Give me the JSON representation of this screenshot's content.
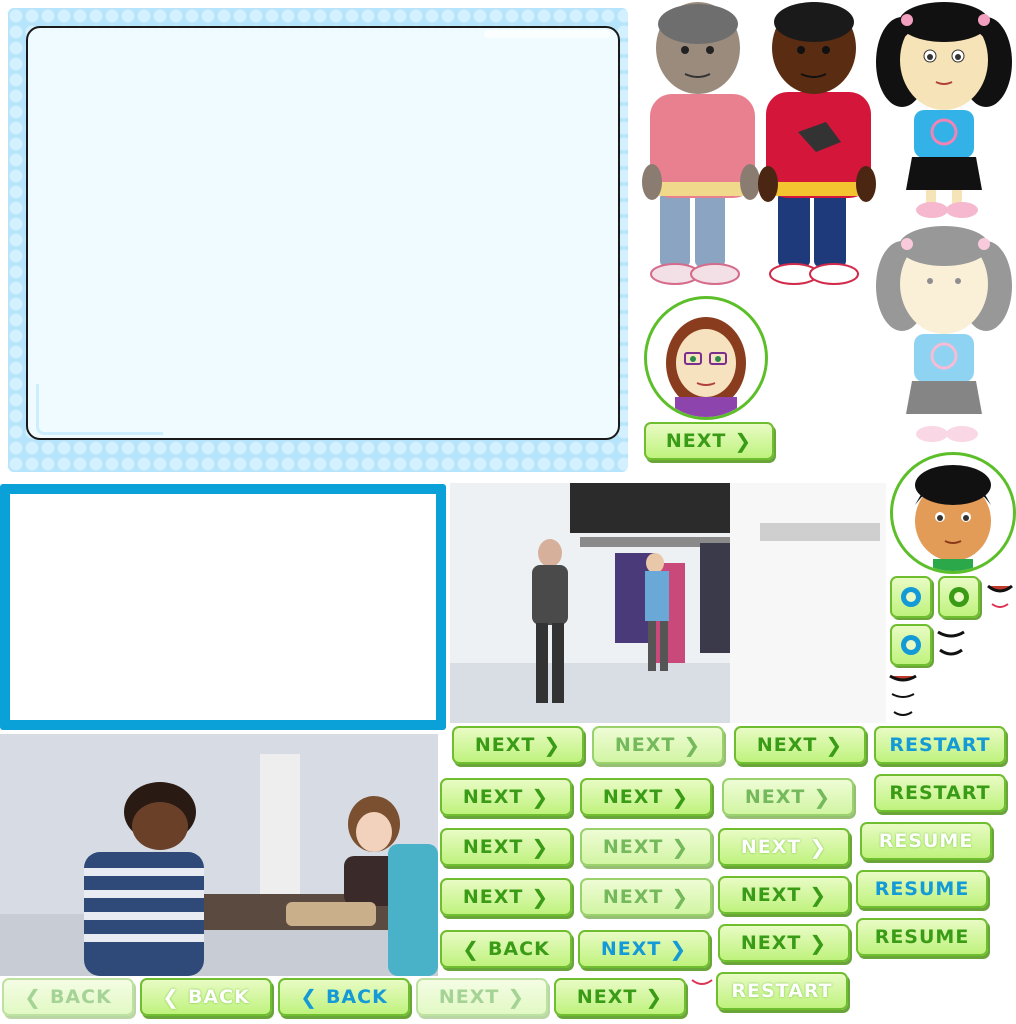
{
  "buttons": {
    "next": "NEXT",
    "back": "BACK",
    "restart": "RESTART",
    "resume": "RESUME"
  },
  "icons": {
    "next_arrow": "chevron-right-icon",
    "back_arrow": "chevron-left-icon",
    "refresh": "refresh-icon"
  },
  "colors": {
    "panel_light_blue": "#b6e4fb",
    "panel_inner": "#f0fbff",
    "panel_blue_border": "#0aa0d8",
    "button_green": "#bff27d",
    "button_text_green": "#3a9c16",
    "button_text_blue": "#149ad6",
    "avatar_ring_green": "#5cbf2a"
  }
}
